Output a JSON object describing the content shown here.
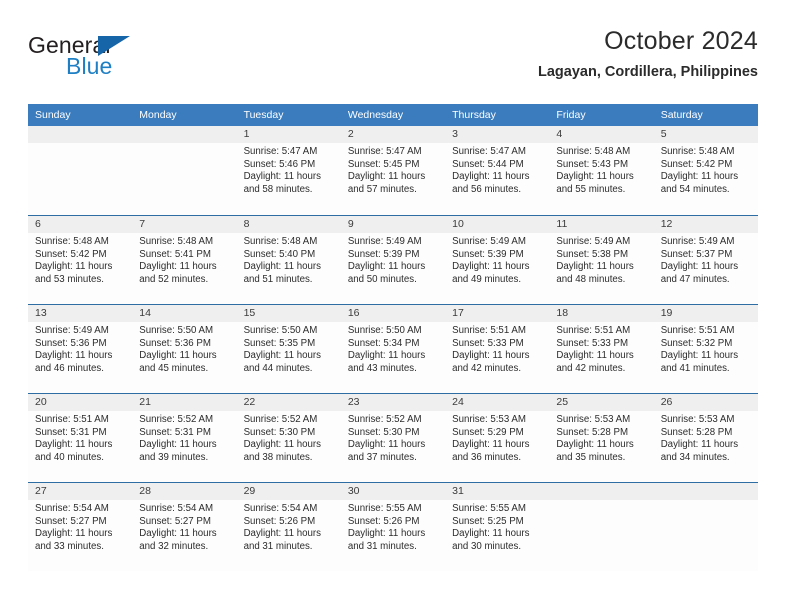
{
  "brand": {
    "name_part1": "General",
    "name_part2": "Blue"
  },
  "header": {
    "title": "October 2024",
    "location": "Lagayan, Cordillera, Philippines"
  },
  "colors": {
    "header_blue": "#3a7cbe",
    "row_divider_blue": "#2e6da4",
    "day_band_gray": "#efefef",
    "brand_blue": "#1f7fc4",
    "logo_flag_blue": "#1565a8"
  },
  "weekdays": [
    "Sunday",
    "Monday",
    "Tuesday",
    "Wednesday",
    "Thursday",
    "Friday",
    "Saturday"
  ],
  "weeks": [
    [
      {
        "day": "",
        "lines": []
      },
      {
        "day": "",
        "lines": []
      },
      {
        "day": "1",
        "lines": [
          "Sunrise: 5:47 AM",
          "Sunset: 5:46 PM",
          "Daylight: 11 hours",
          "and 58 minutes."
        ]
      },
      {
        "day": "2",
        "lines": [
          "Sunrise: 5:47 AM",
          "Sunset: 5:45 PM",
          "Daylight: 11 hours",
          "and 57 minutes."
        ]
      },
      {
        "day": "3",
        "lines": [
          "Sunrise: 5:47 AM",
          "Sunset: 5:44 PM",
          "Daylight: 11 hours",
          "and 56 minutes."
        ]
      },
      {
        "day": "4",
        "lines": [
          "Sunrise: 5:48 AM",
          "Sunset: 5:43 PM",
          "Daylight: 11 hours",
          "and 55 minutes."
        ]
      },
      {
        "day": "5",
        "lines": [
          "Sunrise: 5:48 AM",
          "Sunset: 5:42 PM",
          "Daylight: 11 hours",
          "and 54 minutes."
        ]
      }
    ],
    [
      {
        "day": "6",
        "lines": [
          "Sunrise: 5:48 AM",
          "Sunset: 5:42 PM",
          "Daylight: 11 hours",
          "and 53 minutes."
        ]
      },
      {
        "day": "7",
        "lines": [
          "Sunrise: 5:48 AM",
          "Sunset: 5:41 PM",
          "Daylight: 11 hours",
          "and 52 minutes."
        ]
      },
      {
        "day": "8",
        "lines": [
          "Sunrise: 5:48 AM",
          "Sunset: 5:40 PM",
          "Daylight: 11 hours",
          "and 51 minutes."
        ]
      },
      {
        "day": "9",
        "lines": [
          "Sunrise: 5:49 AM",
          "Sunset: 5:39 PM",
          "Daylight: 11 hours",
          "and 50 minutes."
        ]
      },
      {
        "day": "10",
        "lines": [
          "Sunrise: 5:49 AM",
          "Sunset: 5:39 PM",
          "Daylight: 11 hours",
          "and 49 minutes."
        ]
      },
      {
        "day": "11",
        "lines": [
          "Sunrise: 5:49 AM",
          "Sunset: 5:38 PM",
          "Daylight: 11 hours",
          "and 48 minutes."
        ]
      },
      {
        "day": "12",
        "lines": [
          "Sunrise: 5:49 AM",
          "Sunset: 5:37 PM",
          "Daylight: 11 hours",
          "and 47 minutes."
        ]
      }
    ],
    [
      {
        "day": "13",
        "lines": [
          "Sunrise: 5:49 AM",
          "Sunset: 5:36 PM",
          "Daylight: 11 hours",
          "and 46 minutes."
        ]
      },
      {
        "day": "14",
        "lines": [
          "Sunrise: 5:50 AM",
          "Sunset: 5:36 PM",
          "Daylight: 11 hours",
          "and 45 minutes."
        ]
      },
      {
        "day": "15",
        "lines": [
          "Sunrise: 5:50 AM",
          "Sunset: 5:35 PM",
          "Daylight: 11 hours",
          "and 44 minutes."
        ]
      },
      {
        "day": "16",
        "lines": [
          "Sunrise: 5:50 AM",
          "Sunset: 5:34 PM",
          "Daylight: 11 hours",
          "and 43 minutes."
        ]
      },
      {
        "day": "17",
        "lines": [
          "Sunrise: 5:51 AM",
          "Sunset: 5:33 PM",
          "Daylight: 11 hours",
          "and 42 minutes."
        ]
      },
      {
        "day": "18",
        "lines": [
          "Sunrise: 5:51 AM",
          "Sunset: 5:33 PM",
          "Daylight: 11 hours",
          "and 42 minutes."
        ]
      },
      {
        "day": "19",
        "lines": [
          "Sunrise: 5:51 AM",
          "Sunset: 5:32 PM",
          "Daylight: 11 hours",
          "and 41 minutes."
        ]
      }
    ],
    [
      {
        "day": "20",
        "lines": [
          "Sunrise: 5:51 AM",
          "Sunset: 5:31 PM",
          "Daylight: 11 hours",
          "and 40 minutes."
        ]
      },
      {
        "day": "21",
        "lines": [
          "Sunrise: 5:52 AM",
          "Sunset: 5:31 PM",
          "Daylight: 11 hours",
          "and 39 minutes."
        ]
      },
      {
        "day": "22",
        "lines": [
          "Sunrise: 5:52 AM",
          "Sunset: 5:30 PM",
          "Daylight: 11 hours",
          "and 38 minutes."
        ]
      },
      {
        "day": "23",
        "lines": [
          "Sunrise: 5:52 AM",
          "Sunset: 5:30 PM",
          "Daylight: 11 hours",
          "and 37 minutes."
        ]
      },
      {
        "day": "24",
        "lines": [
          "Sunrise: 5:53 AM",
          "Sunset: 5:29 PM",
          "Daylight: 11 hours",
          "and 36 minutes."
        ]
      },
      {
        "day": "25",
        "lines": [
          "Sunrise: 5:53 AM",
          "Sunset: 5:28 PM",
          "Daylight: 11 hours",
          "and 35 minutes."
        ]
      },
      {
        "day": "26",
        "lines": [
          "Sunrise: 5:53 AM",
          "Sunset: 5:28 PM",
          "Daylight: 11 hours",
          "and 34 minutes."
        ]
      }
    ],
    [
      {
        "day": "27",
        "lines": [
          "Sunrise: 5:54 AM",
          "Sunset: 5:27 PM",
          "Daylight: 11 hours",
          "and 33 minutes."
        ]
      },
      {
        "day": "28",
        "lines": [
          "Sunrise: 5:54 AM",
          "Sunset: 5:27 PM",
          "Daylight: 11 hours",
          "and 32 minutes."
        ]
      },
      {
        "day": "29",
        "lines": [
          "Sunrise: 5:54 AM",
          "Sunset: 5:26 PM",
          "Daylight: 11 hours",
          "and 31 minutes."
        ]
      },
      {
        "day": "30",
        "lines": [
          "Sunrise: 5:55 AM",
          "Sunset: 5:26 PM",
          "Daylight: 11 hours",
          "and 31 minutes."
        ]
      },
      {
        "day": "31",
        "lines": [
          "Sunrise: 5:55 AM",
          "Sunset: 5:25 PM",
          "Daylight: 11 hours",
          "and 30 minutes."
        ]
      },
      {
        "day": "",
        "lines": []
      },
      {
        "day": "",
        "lines": []
      }
    ]
  ]
}
